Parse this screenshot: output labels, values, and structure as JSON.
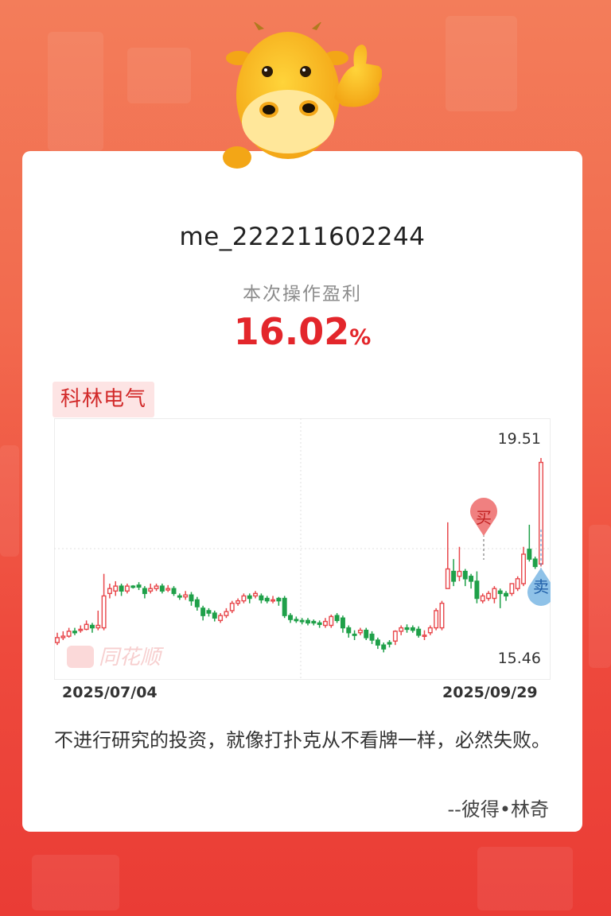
{
  "user": {
    "name": "me_222211602244"
  },
  "profit": {
    "label": "本次操作盈利",
    "value": "16.02",
    "unit": "%"
  },
  "stock": {
    "name": "科林电气"
  },
  "chart_data": {
    "type": "candlestick",
    "high_label": "19.51",
    "low_label": "15.46",
    "start_date": "2025/07/04",
    "end_date": "2025/09/29",
    "buy_label": "买",
    "sell_label": "卖",
    "watermark": "同花顺",
    "colors": {
      "up": "#e8474b",
      "down": "#1fa049",
      "buy": "#f08080",
      "sell": "#8fc2e8"
    },
    "ylim": [
      15.46,
      19.51
    ],
    "candles": [
      [
        15.75,
        15.85,
        15.95,
        15.7
      ],
      [
        15.85,
        15.88,
        15.98,
        15.8
      ],
      [
        15.88,
        15.98,
        16.05,
        15.85
      ],
      [
        15.98,
        15.95,
        16.05,
        15.9
      ],
      [
        16.0,
        16.02,
        16.1,
        15.95
      ],
      [
        16.02,
        16.12,
        16.2,
        16.0
      ],
      [
        16.1,
        16.05,
        16.15,
        15.95
      ],
      [
        16.05,
        16.1,
        16.4,
        16.0
      ],
      [
        16.05,
        16.7,
        17.15,
        16.0
      ],
      [
        16.75,
        16.85,
        16.95,
        16.65
      ],
      [
        16.8,
        16.9,
        17.0,
        16.7
      ],
      [
        16.9,
        16.8,
        16.95,
        16.7
      ],
      [
        16.8,
        16.9,
        16.95,
        16.75
      ],
      [
        16.9,
        16.88,
        16.92,
        16.85
      ],
      [
        16.92,
        16.88,
        16.98,
        16.82
      ],
      [
        16.85,
        16.75,
        16.9,
        16.65
      ],
      [
        16.8,
        16.85,
        16.95,
        16.75
      ],
      [
        16.85,
        16.9,
        16.95,
        16.8
      ],
      [
        16.9,
        16.8,
        16.95,
        16.75
      ],
      [
        16.82,
        16.85,
        16.92,
        16.78
      ],
      [
        16.85,
        16.75,
        16.9,
        16.7
      ],
      [
        16.7,
        16.68,
        16.75,
        16.62
      ],
      [
        16.68,
        16.72,
        16.8,
        16.62
      ],
      [
        16.72,
        16.6,
        16.78,
        16.5
      ],
      [
        16.62,
        16.48,
        16.68,
        16.4
      ],
      [
        16.45,
        16.3,
        16.5,
        16.2
      ],
      [
        16.4,
        16.35,
        16.45,
        16.28
      ],
      [
        16.35,
        16.25,
        16.4,
        16.18
      ],
      [
        16.2,
        16.3,
        16.35,
        16.15
      ],
      [
        16.3,
        16.38,
        16.45,
        16.25
      ],
      [
        16.4,
        16.55,
        16.6,
        16.35
      ],
      [
        16.55,
        16.6,
        16.65,
        16.5
      ],
      [
        16.6,
        16.7,
        16.75,
        16.55
      ],
      [
        16.7,
        16.65,
        16.75,
        16.55
      ],
      [
        16.7,
        16.75,
        16.8,
        16.65
      ],
      [
        16.7,
        16.62,
        16.75,
        16.55
      ],
      [
        16.65,
        16.6,
        16.7,
        16.55
      ],
      [
        16.6,
        16.62,
        16.7,
        16.55
      ],
      [
        16.65,
        16.6,
        16.68,
        16.5
      ],
      [
        16.65,
        16.3,
        16.7,
        16.25
      ],
      [
        16.3,
        16.22,
        16.35,
        16.15
      ],
      [
        16.22,
        16.2,
        16.28,
        16.15
      ],
      [
        16.2,
        16.18,
        16.25,
        16.12
      ],
      [
        16.2,
        16.15,
        16.25,
        16.1
      ],
      [
        16.18,
        16.15,
        16.22,
        16.1
      ],
      [
        16.15,
        16.12,
        16.2,
        16.05
      ],
      [
        16.1,
        16.18,
        16.25,
        16.05
      ],
      [
        16.1,
        16.28,
        16.32,
        16.05
      ],
      [
        16.3,
        16.2,
        16.35,
        16.15
      ],
      [
        16.25,
        16.05,
        16.3,
        15.95
      ],
      [
        16.05,
        15.95,
        16.1,
        15.85
      ],
      [
        15.92,
        15.9,
        16.0,
        15.8
      ],
      [
        15.95,
        16.0,
        16.05,
        15.9
      ],
      [
        16.0,
        15.85,
        16.05,
        15.8
      ],
      [
        15.92,
        15.8,
        15.98,
        15.72
      ],
      [
        15.8,
        15.7,
        15.85,
        15.62
      ],
      [
        15.7,
        15.62,
        15.75,
        15.55
      ],
      [
        15.75,
        15.72,
        15.8,
        15.65
      ],
      [
        15.78,
        15.98,
        16.0,
        15.7
      ],
      [
        15.98,
        16.05,
        16.1,
        15.9
      ],
      [
        16.05,
        16.02,
        16.12,
        15.95
      ],
      [
        16.05,
        16.0,
        16.1,
        15.95
      ],
      [
        16.02,
        15.9,
        16.08,
        15.85
      ],
      [
        15.88,
        15.9,
        16.0,
        15.8
      ],
      [
        15.95,
        16.05,
        16.1,
        15.9
      ],
      [
        16.05,
        16.4,
        16.45,
        16.0
      ],
      [
        16.05,
        16.55,
        16.6,
        16.0
      ],
      [
        16.85,
        17.25,
        18.2,
        16.9
      ],
      [
        17.2,
        17.0,
        17.45,
        16.9
      ],
      [
        17.1,
        17.2,
        17.7,
        17.0
      ],
      [
        17.2,
        17.05,
        17.25,
        16.9
      ],
      [
        17.1,
        17.0,
        17.15,
        16.85
      ],
      [
        17.0,
        16.65,
        17.2,
        16.55
      ],
      [
        16.6,
        16.7,
        16.75,
        16.55
      ],
      [
        16.65,
        16.75,
        16.8,
        16.6
      ],
      [
        16.65,
        16.85,
        16.9,
        16.55
      ],
      [
        16.8,
        16.75,
        16.85,
        16.45
      ],
      [
        16.75,
        16.7,
        16.8,
        16.6
      ],
      [
        16.75,
        16.95,
        16.95,
        16.7
      ],
      [
        16.85,
        17.05,
        17.1,
        16.8
      ],
      [
        16.95,
        17.55,
        17.7,
        16.9
      ],
      [
        17.65,
        17.45,
        18.15,
        17.4
      ],
      [
        17.45,
        17.3,
        17.5,
        17.25
      ],
      [
        17.35,
        19.42,
        19.51,
        17.3
      ]
    ]
  }
}
